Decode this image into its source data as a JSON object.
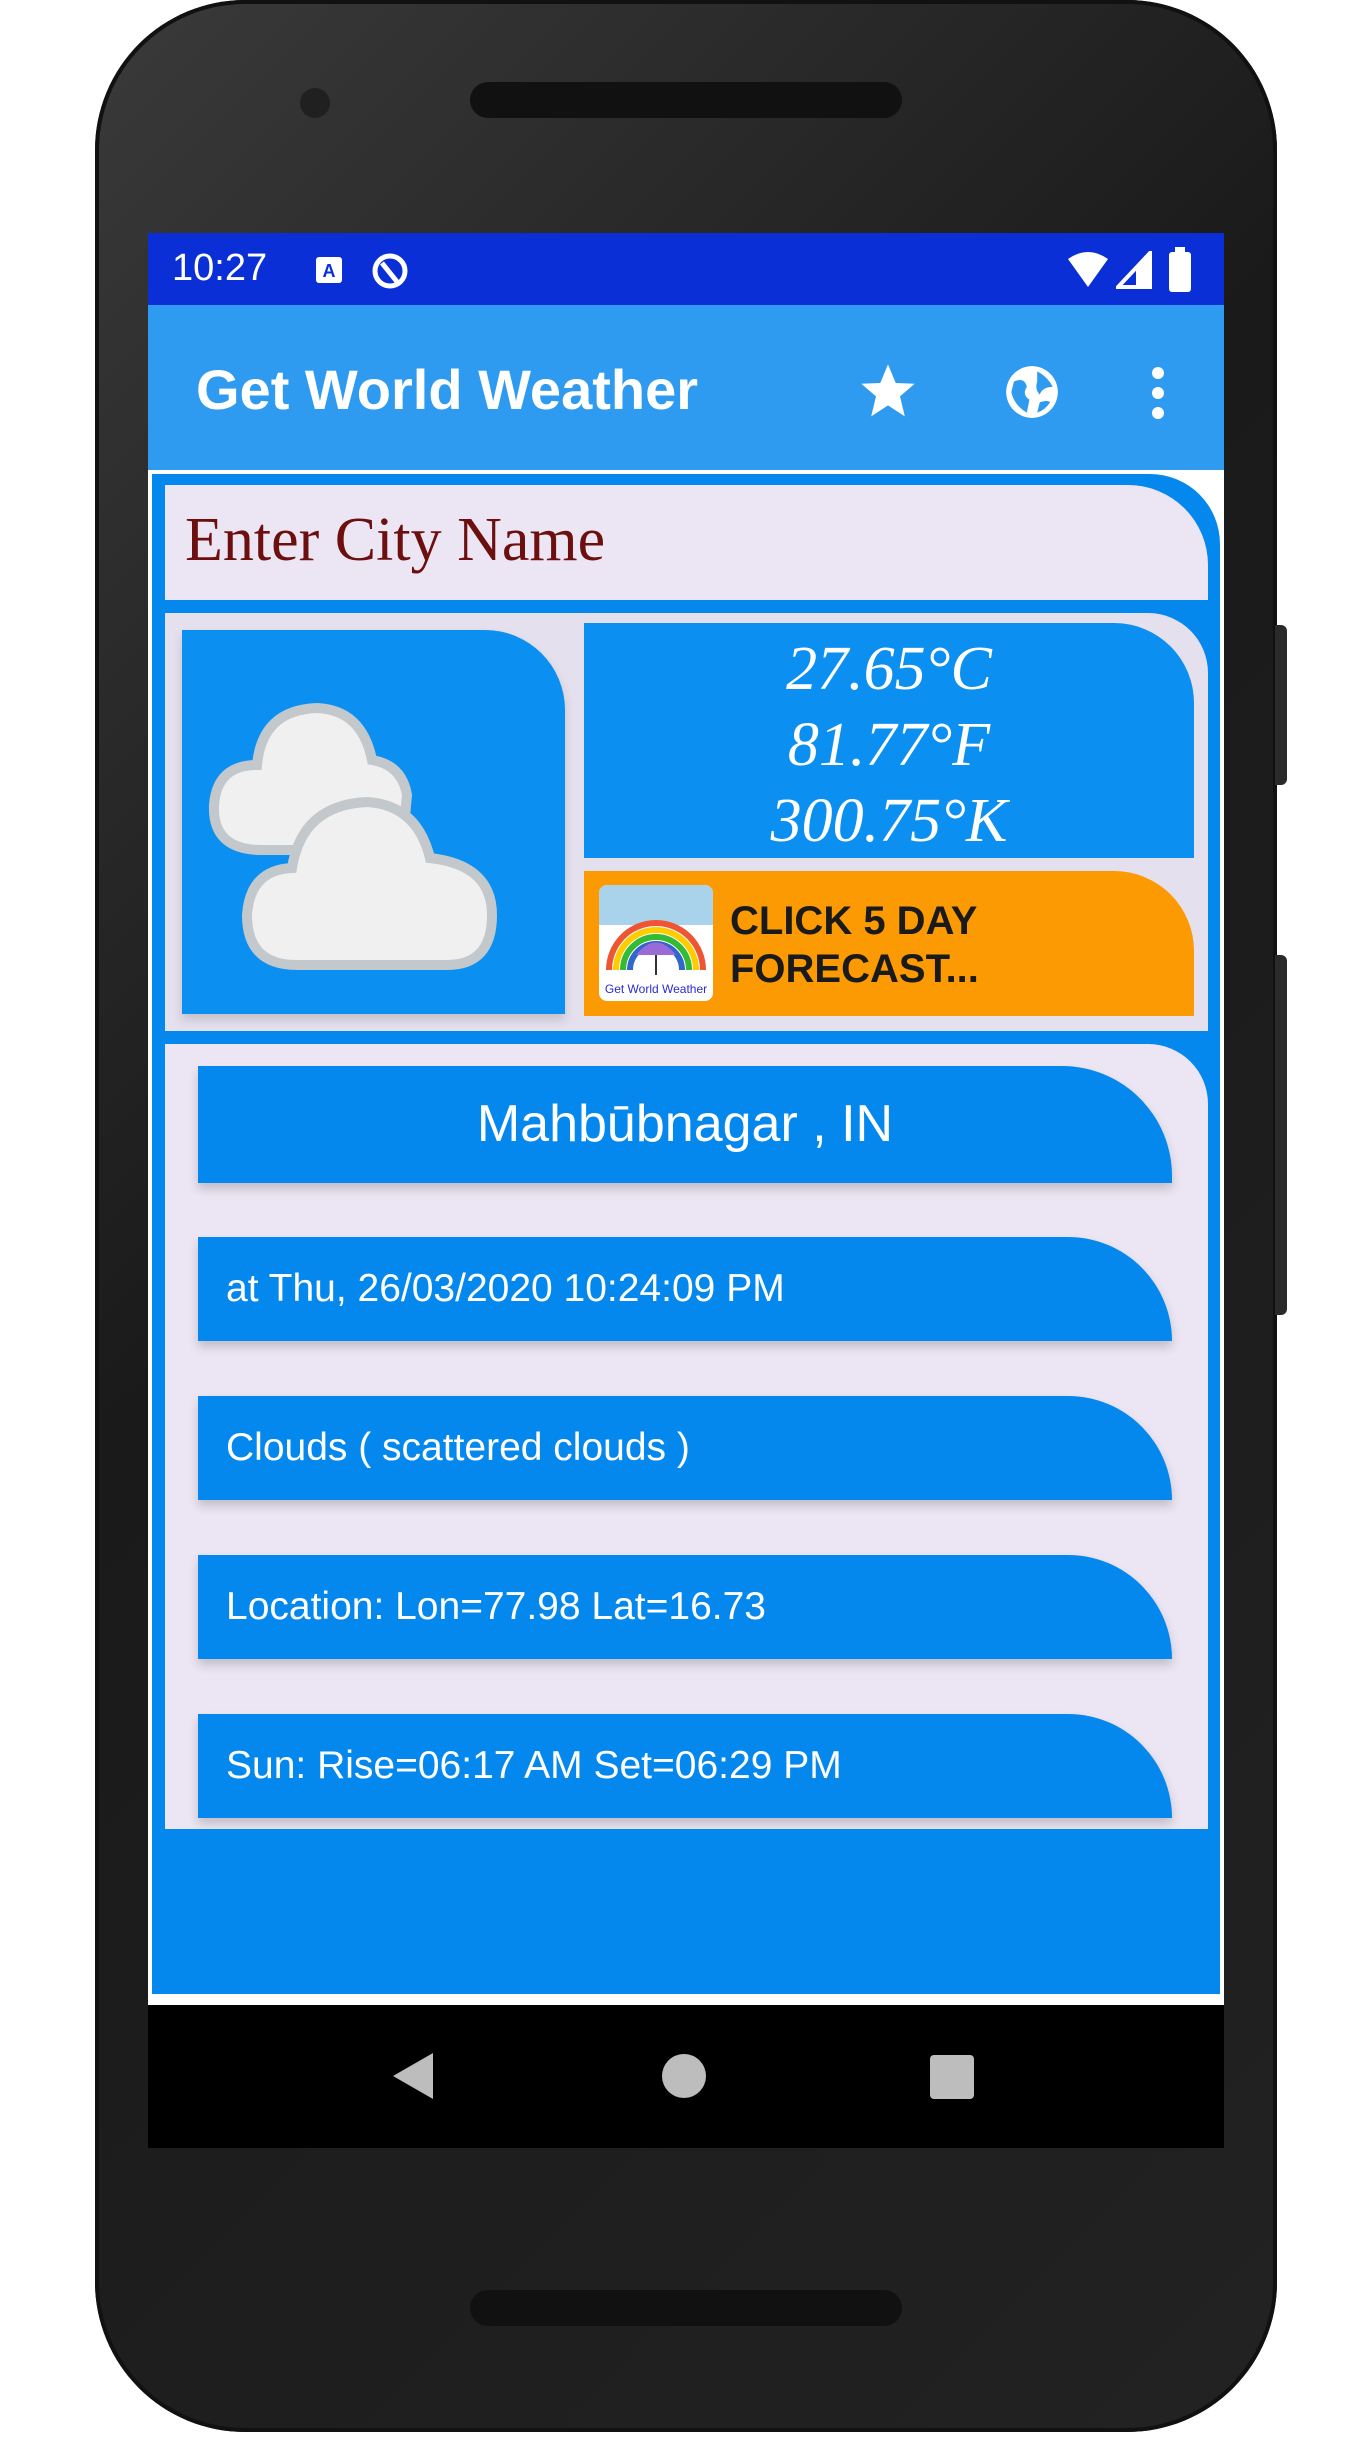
{
  "status_bar": {
    "time": "10:27",
    "icons": [
      "a-notification-icon",
      "q-notification-icon",
      "wifi-icon",
      "signal-icon",
      "battery-icon"
    ]
  },
  "app_bar": {
    "title": "Get World Weather",
    "actions": [
      "star-icon",
      "globe-icon",
      "more-vert-icon"
    ]
  },
  "city_input": {
    "placeholder": "Enter City Name"
  },
  "weather": {
    "icon": "scattered-clouds-icon",
    "celsius": "27.65°C",
    "fahrenheit": "81.77°F",
    "kelvin": "300.75°K",
    "forecast_button": {
      "line1": "CLICK 5 DAY",
      "line2": "FORECAST...",
      "logo_text": "Get World Weather"
    }
  },
  "info": {
    "city": "Mahbūbnagar , IN",
    "datetime": "at Thu, 26/03/2020 10:24:09 PM",
    "condition": "Clouds ( scattered clouds )",
    "location": "Location: Lon=77.98  Lat=16.73",
    "sun": "Sun: Rise=06:17 AM  Set=06:29 PM"
  },
  "colors": {
    "status_bar": "#0b2fd6",
    "app_bar": "#2f9bf0",
    "panel_blue": "#0588ee",
    "forecast_orange": "#fb9a02",
    "title_text": "#6d0f0f",
    "card_bg": "#ece6f4"
  }
}
